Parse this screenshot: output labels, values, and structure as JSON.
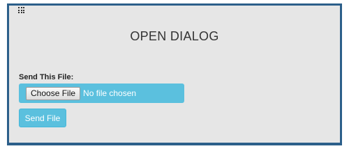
{
  "dialog": {
    "icon": "grid-menu-icon",
    "title": "OPEN DIALOG"
  },
  "form": {
    "file_label": "Send This File:",
    "choose_button": "Choose File",
    "file_status": "No file chosen",
    "submit_button": "Send File"
  },
  "colors": {
    "frame_border": "#2c5f8a",
    "panel_background": "#e6e6e6",
    "accent": "#5bc0de"
  }
}
